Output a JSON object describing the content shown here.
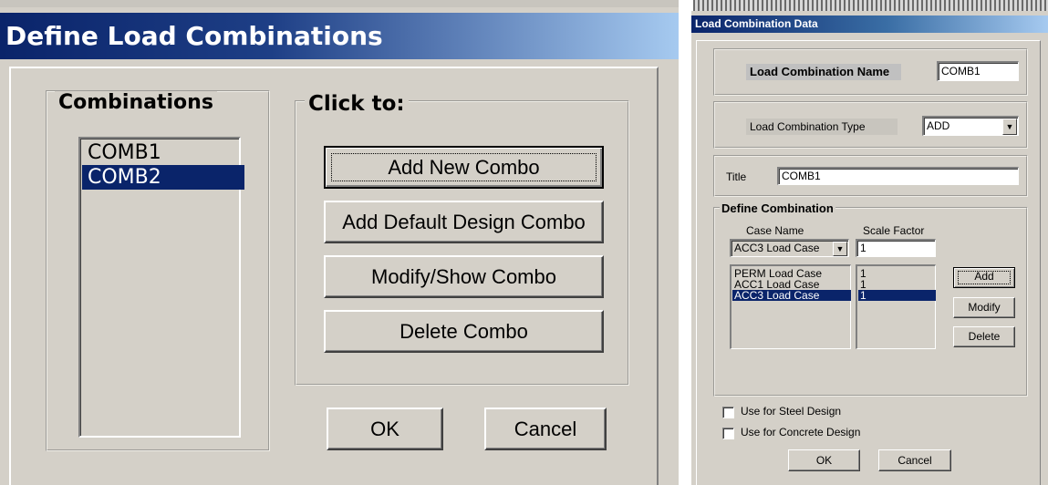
{
  "left_dialog": {
    "title": "Define Load Combinations",
    "combinations_group_label": "Combinations",
    "click_group_label": "Click to:",
    "combinations": [
      {
        "label": "COMB1",
        "selected": false
      },
      {
        "label": "COMB2",
        "selected": true
      }
    ],
    "buttons": {
      "add_new": "Add New Combo",
      "add_default": "Add Default Design Combo",
      "modify_show": "Modify/Show Combo",
      "delete": "Delete Combo",
      "ok": "OK",
      "cancel": "Cancel"
    }
  },
  "right_dialog": {
    "title": "Load Combination Data",
    "name_label": "Load Combination Name",
    "name_value": "COMB1",
    "type_label": "Load Combination Type",
    "type_value": "ADD",
    "title_label": "Title",
    "title_value": "COMB1",
    "define_group_label": "Define Combination",
    "case_name_header": "Case Name",
    "scale_factor_header": "Scale Factor",
    "case_select_value": "ACC3 Load Case",
    "scale_factor_value": "1",
    "cases": [
      {
        "name": "PERM Load Case",
        "factor": "1",
        "selected": false
      },
      {
        "name": "ACC1 Load Case",
        "factor": "1",
        "selected": false
      },
      {
        "name": "ACC3 Load Case",
        "factor": "1",
        "selected": true
      }
    ],
    "buttons": {
      "add": "Add",
      "modify": "Modify",
      "delete": "Delete",
      "ok": "OK",
      "cancel": "Cancel"
    },
    "checkboxes": {
      "steel_design": "Use for Steel Design",
      "concrete_design": "Use for Concrete Design"
    }
  },
  "colors": {
    "dialog_bg": "#d4d0c8",
    "titlebar": "#0a246a",
    "selection": "#0a246a"
  }
}
